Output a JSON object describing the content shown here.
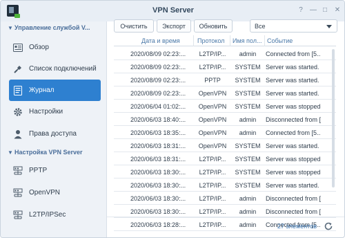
{
  "window": {
    "title": "VPN Server"
  },
  "window_controls": {
    "help": "?",
    "minimize": "—",
    "maximize": "□",
    "close": "✕"
  },
  "sidebar": {
    "section1": "Управление службой V...",
    "items1": [
      {
        "label": "Обзор",
        "icon": "overview-icon"
      },
      {
        "label": "Список подключений",
        "icon": "connection-list-icon"
      },
      {
        "label": "Журнал",
        "icon": "log-icon",
        "active": true
      },
      {
        "label": "Настройки",
        "icon": "gear-icon"
      },
      {
        "label": "Права доступа",
        "icon": "user-icon"
      }
    ],
    "section2": "Настройка VPN Server",
    "items2": [
      {
        "label": "PPTP",
        "icon": "network-icon"
      },
      {
        "label": "OpenVPN",
        "icon": "network-icon"
      },
      {
        "label": "L2TP/IPSec",
        "icon": "network-icon"
      }
    ]
  },
  "toolbar": {
    "clear": "Очистить",
    "export": "Экспорт",
    "refresh": "Обновить",
    "filter_value": "Все"
  },
  "table": {
    "headers": [
      "Дата и время",
      "Протокол",
      "Имя пол...",
      "Событие"
    ],
    "rows": [
      [
        "2020/08/09 02:23:...",
        "L2TP/IP...",
        "admin",
        "Connected from [5...."
      ],
      [
        "2020/08/09 02:23:...",
        "L2TP/IP...",
        "SYSTEM",
        "Server was started."
      ],
      [
        "2020/08/09 02:23:...",
        "PPTP",
        "SYSTEM",
        "Server was started."
      ],
      [
        "2020/08/09 02:23:...",
        "OpenVPN",
        "SYSTEM",
        "Server was started."
      ],
      [
        "2020/06/04 01:02:...",
        "OpenVPN",
        "SYSTEM",
        "Server was stopped."
      ],
      [
        "2020/06/03 18:40:...",
        "OpenVPN",
        "admin",
        "Disconnected from [..."
      ],
      [
        "2020/06/03 18:35:...",
        "OpenVPN",
        "admin",
        "Connected from [5...."
      ],
      [
        "2020/06/03 18:31:...",
        "OpenVPN",
        "SYSTEM",
        "Server was started."
      ],
      [
        "2020/06/03 18:31:...",
        "L2TP/IP...",
        "SYSTEM",
        "Server was stopped."
      ],
      [
        "2020/06/03 18:30:...",
        "L2TP/IP...",
        "SYSTEM",
        "Server was stopped."
      ],
      [
        "2020/06/03 18:30:...",
        "L2TP/IP...",
        "SYSTEM",
        "Server was started."
      ],
      [
        "2020/06/03 18:30:...",
        "L2TP/IP...",
        "admin",
        "Disconnected from [..."
      ],
      [
        "2020/06/03 18:30:...",
        "L2TP/IP...",
        "admin",
        "Disconnected from [..."
      ],
      [
        "2020/06/03 18:28:...",
        "L2TP/IP...",
        "admin",
        "Connected from [5...."
      ]
    ]
  },
  "footer": {
    "count": "27 элементов"
  },
  "colors": {
    "accent": "#2e80d0",
    "header_text": "#4a78a8",
    "section_text": "#4a6e9a"
  }
}
